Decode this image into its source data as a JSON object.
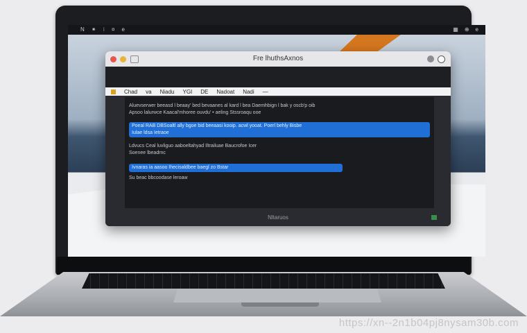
{
  "menubar": {
    "left_items": [
      "",
      "N",
      "⁕",
      "⁝",
      "¤",
      "e"
    ],
    "right_items": [
      "▦",
      "⊕",
      "e"
    ]
  },
  "window": {
    "title": "Fre lhuthsAxnos",
    "toolbar": [
      "Chad",
      "va",
      "Niadu",
      "YGI",
      "DE",
      "Nadoat",
      "Nadi",
      "—"
    ],
    "content": {
      "line1": "Aluevserwer beeasd l beaay' bed bevaanes al kard l bea Daemhbign l bak y oscb'p oib",
      "line2": "Apsoo lalurwce Kaacal'mhoree ouvdu' • aeling Stssroaqu ooe",
      "highlight1_a": "Poeal RAB DBSoaltl ally bgoe bid beeaasi kooip. acwl yooat. Poerl behly Bisbe",
      "highlight1_b": "Iulae ldsa Ietraoe",
      "line3": "Ldvucs Ceal luvliguo aaboeltahyad Iltrailuae Baucrofoe Icer",
      "line4": "Soenee lbeadrnc",
      "highlight2": "Ivnaras ia aasoo Ihecisaldbee baegl zo Bstar",
      "line5": "Su beac bbcoodase leroaw"
    },
    "footer": "Nltaruos"
  },
  "watermark": "https://xn--2n1b04pj8nysam30b.com",
  "colors": {
    "highlight": "#1f6fd6",
    "window_bg": "#2a2b30",
    "orange_accent": "#d5771f"
  }
}
